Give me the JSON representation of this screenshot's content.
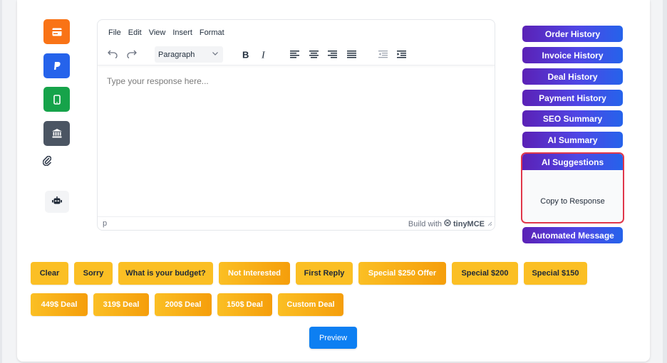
{
  "payment_methods": [
    {
      "name": "card-icon",
      "color": "#f97316"
    },
    {
      "name": "paypal-icon",
      "color": "#2563eb"
    },
    {
      "name": "mobile-icon",
      "color": "#16a34a"
    },
    {
      "name": "bank-icon",
      "color": "#4b5563"
    }
  ],
  "editor": {
    "menu": [
      "File",
      "Edit",
      "View",
      "Insert",
      "Format"
    ],
    "format_select": "Paragraph",
    "placeholder": "Type your response here...",
    "status_path": "p",
    "branding_prefix": "Build with",
    "branding_name": "tinyMCE"
  },
  "side_buttons": [
    "Order History",
    "Invoice History",
    "Deal History",
    "Payment History",
    "SEO Summary",
    "AI Summary"
  ],
  "ai_suggestions": {
    "title": "AI Suggestions",
    "copy_label": "Copy to Response"
  },
  "automated_message": "Automated Message",
  "quick_replies_row1": [
    "Clear",
    "Sorry",
    "What is your budget?",
    "Not Interested",
    "First Reply",
    "Special $250 Offer",
    "Special $200",
    "Special $150"
  ],
  "quick_replies_row2": [
    "449$ Deal",
    "319$ Deal",
    "200$ Deal",
    "150$ Deal",
    "Custom Deal"
  ],
  "preview_label": "Preview",
  "colors": {
    "accent_purple": "#5b21b6",
    "accent_blue": "#2563eb",
    "amber": "#fbbf24",
    "highlight_red": "#e0374a",
    "preview_blue": "#0d7ff2"
  }
}
